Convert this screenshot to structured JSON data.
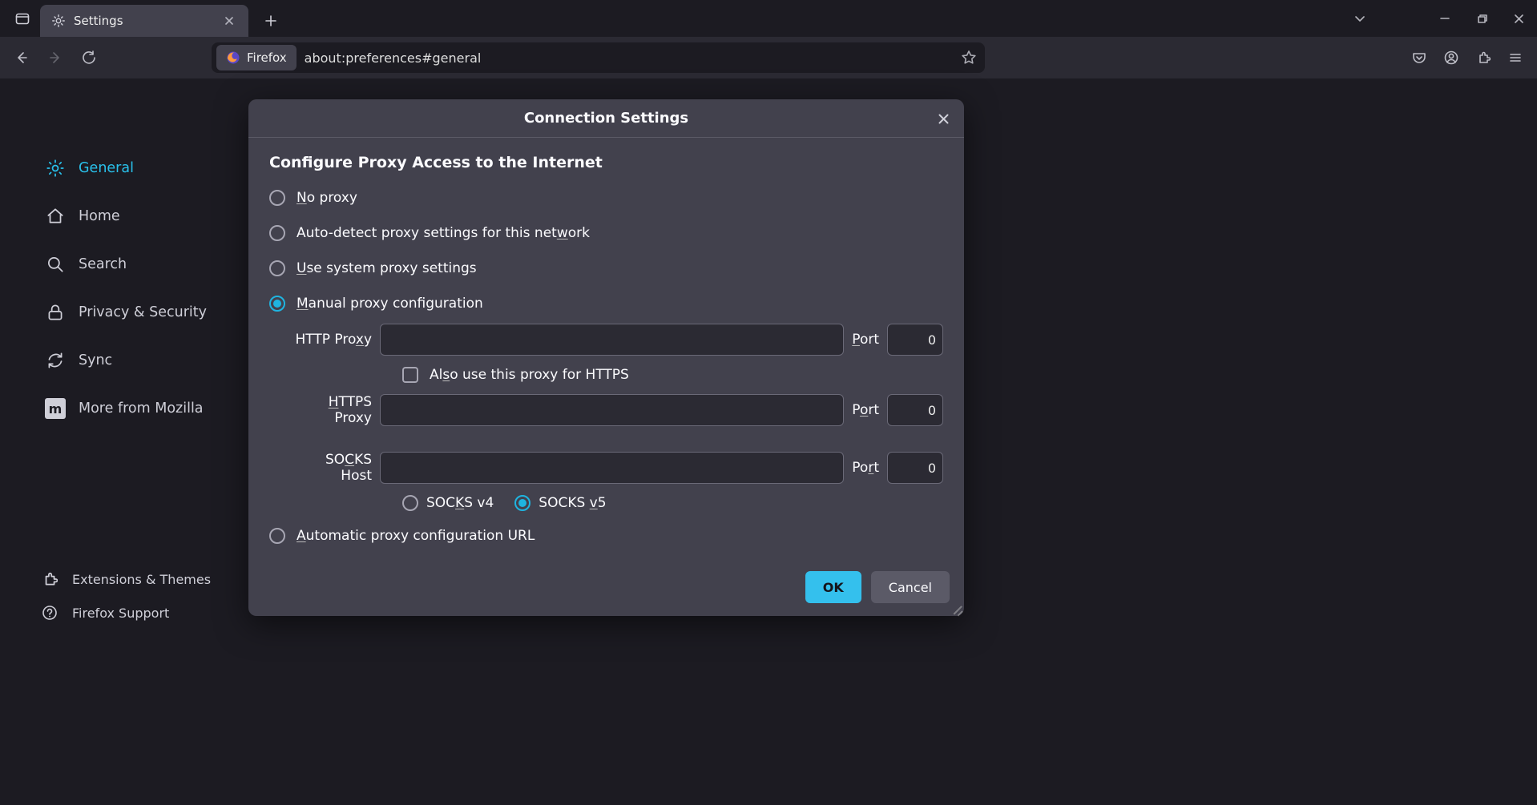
{
  "tab": {
    "title": "Settings"
  },
  "url": {
    "identity": "Firefox",
    "value": "about:preferences#general"
  },
  "sidebar": {
    "items": [
      {
        "label": "General"
      },
      {
        "label": "Home"
      },
      {
        "label": "Search"
      },
      {
        "label": "Privacy & Security"
      },
      {
        "label": "Sync"
      },
      {
        "label": "More from Mozilla"
      }
    ]
  },
  "bottomlinks": {
    "ext": "Extensions & Themes",
    "support": "Firefox Support"
  },
  "dialog": {
    "title": "Connection Settings",
    "heading": "Configure Proxy Access to the Internet",
    "options": {
      "noproxy": "No proxy",
      "auto": "Auto-detect proxy settings for this network",
      "system": "Use system proxy settings",
      "manual": "Manual proxy configuration",
      "autourl": "Automatic proxy configuration URL"
    },
    "labels": {
      "http": "HTTP Proxy",
      "https": "HTTPS Proxy",
      "socks": "SOCKS Host",
      "port": "Port",
      "share": "Also use this proxy for HTTPS",
      "socksv4": "SOCKS v4",
      "socksv5": "SOCKS v5"
    },
    "values": {
      "http_host": "",
      "http_port": "0",
      "https_host": "",
      "https_port": "0",
      "socks_host": "",
      "socks_port": "0"
    },
    "buttons": {
      "ok": "OK",
      "cancel": "Cancel"
    }
  }
}
